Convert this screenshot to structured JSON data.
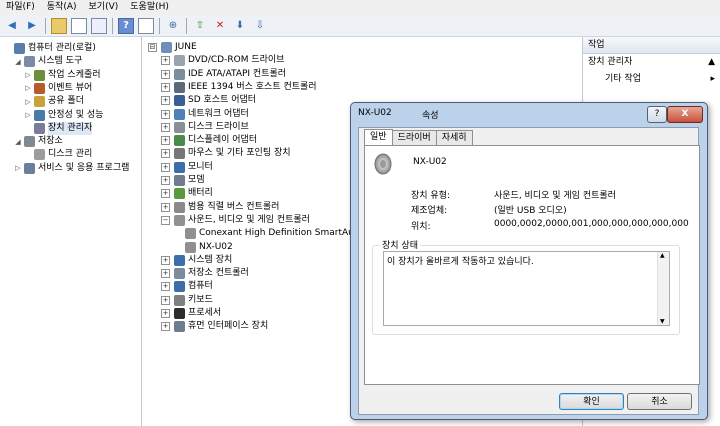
{
  "menu": [
    "파일(F)",
    "동작(A)",
    "보기(V)",
    "도움말(H)"
  ],
  "left_tree": [
    {
      "label": "컴퓨터 관리(로컬)",
      "indent": 0,
      "exp": ""
    },
    {
      "label": "시스템 도구",
      "indent": 1,
      "exp": "◢"
    },
    {
      "label": "작업 스케줄러",
      "indent": 2,
      "exp": "▷"
    },
    {
      "label": "이벤트 뷰어",
      "indent": 2,
      "exp": "▷"
    },
    {
      "label": "공유 폴더",
      "indent": 2,
      "exp": "▷"
    },
    {
      "label": "안정성 및 성능",
      "indent": 2,
      "exp": "▷"
    },
    {
      "label": "장치 관리자",
      "indent": 2,
      "exp": ""
    },
    {
      "label": "저장소",
      "indent": 1,
      "exp": "◢"
    },
    {
      "label": "디스크 관리",
      "indent": 2,
      "exp": ""
    },
    {
      "label": "서비스 및 응용 프로그램",
      "indent": 1,
      "exp": "▷"
    }
  ],
  "device_tree": [
    {
      "label": "JUNE",
      "indent": 0,
      "exp": "⊟",
      "color": "#6d8fb8"
    },
    {
      "label": "DVD/CD-ROM 드라이브",
      "indent": 1,
      "exp": "+",
      "color": "#9aa4ad"
    },
    {
      "label": "IDE ATA/ATAPI 컨트롤러",
      "indent": 1,
      "exp": "+",
      "color": "#7d8c9c"
    },
    {
      "label": "IEEE 1394 버스 호스트 컨트롤러",
      "indent": 1,
      "exp": "+",
      "color": "#5b6b7b"
    },
    {
      "label": "SD 호스트 어댑터",
      "indent": 1,
      "exp": "+",
      "color": "#3a5f95"
    },
    {
      "label": "네트워크 어댑터",
      "indent": 1,
      "exp": "+",
      "color": "#4f7fb7"
    },
    {
      "label": "디스크 드라이브",
      "indent": 1,
      "exp": "+",
      "color": "#8a8f95"
    },
    {
      "label": "디스플레이 어댑터",
      "indent": 1,
      "exp": "+",
      "color": "#4c8a4c"
    },
    {
      "label": "마우스 및 기타 포인팅 장치",
      "indent": 1,
      "exp": "+",
      "color": "#777777"
    },
    {
      "label": "모니터",
      "indent": 1,
      "exp": "+",
      "color": "#3d6ea8"
    },
    {
      "label": "모뎀",
      "indent": 1,
      "exp": "+",
      "color": "#6f7d8a"
    },
    {
      "label": "배터리",
      "indent": 1,
      "exp": "+",
      "color": "#5a9a3f"
    },
    {
      "label": "범용 직렬 버스 컨트롤러",
      "indent": 1,
      "exp": "+",
      "color": "#8a8a8a"
    },
    {
      "label": "사운드, 비디오 및 게임 컨트롤러",
      "indent": 1,
      "exp": "−",
      "color": "#909090"
    },
    {
      "label": "Conexant High Definition SmartAudio",
      "indent": 2,
      "exp": "",
      "color": "#909090"
    },
    {
      "label": "NX-U02",
      "indent": 2,
      "exp": "",
      "color": "#909090"
    },
    {
      "label": "시스템 장치",
      "indent": 1,
      "exp": "+",
      "color": "#3d6ea8"
    },
    {
      "label": "저장소 컨트롤러",
      "indent": 1,
      "exp": "+",
      "color": "#7d8c9c"
    },
    {
      "label": "컴퓨터",
      "indent": 1,
      "exp": "+",
      "color": "#3d6ea8"
    },
    {
      "label": "키보드",
      "indent": 1,
      "exp": "+",
      "color": "#808080"
    },
    {
      "label": "프로세서",
      "indent": 1,
      "exp": "+",
      "color": "#2d2d2d"
    },
    {
      "label": "휴먼 인터페이스 장치",
      "indent": 1,
      "exp": "+",
      "color": "#6d7d8d"
    }
  ],
  "actions": {
    "header": "작업",
    "section": "장치 관리자",
    "section_arrow": "▲",
    "sub": "기타 작업",
    "sub_arrow": "▸"
  },
  "dialog": {
    "title_device": "NX-U02",
    "title_suffix": "속성",
    "help_btn": "?",
    "close_btn": "X",
    "tabs": [
      "일반",
      "드라이버",
      "자세히"
    ],
    "device_name": "NX-U02",
    "labels": {
      "type": "장치 유형:",
      "maker": "제조업체:",
      "location": "위치:"
    },
    "values": {
      "type": "사운드, 비디오 및 게임 컨트롤러",
      "maker": "(일반 USB 오디오)",
      "location": "0000,0002,0000,001,000,000,000,000,000"
    },
    "status_title": "장치 상태",
    "status_text": "이 장치가 올바르게 작동하고 있습니다.",
    "ok": "확인",
    "cancel": "취소"
  }
}
